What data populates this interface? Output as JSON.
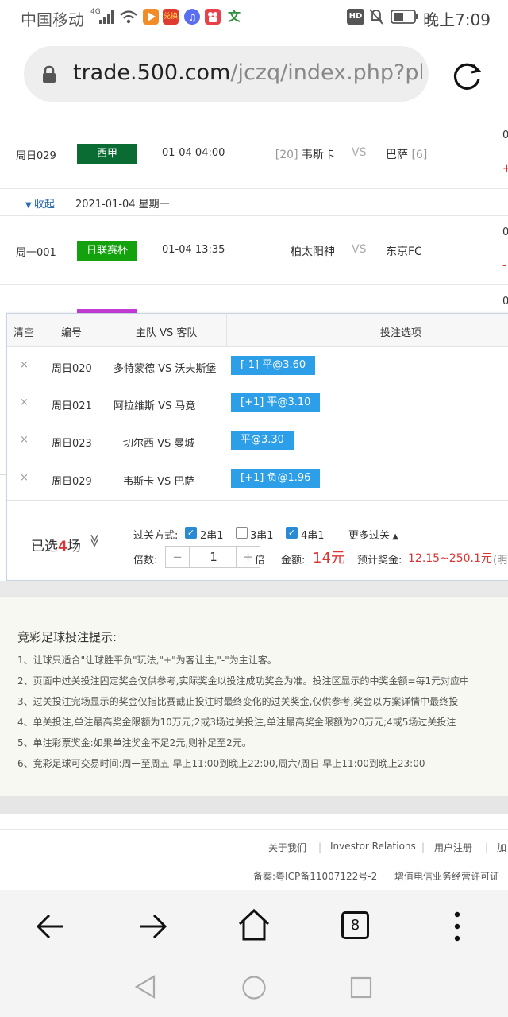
{
  "status": {
    "carrier": "中国移动",
    "net": "4G",
    "hd": "HD",
    "time": "晚上7:09",
    "app_icon_3_text": "兑换",
    "app_icon_6_text": "文"
  },
  "browser": {
    "url_domain": "trade.500.com",
    "url_path": "/jczq/index.php?pla",
    "tab_count": "8"
  },
  "matches_top": [
    {
      "code": "周日029",
      "league": "西甲",
      "league_color": "#0a6b33",
      "time": "01-04 04:00",
      "home_rank": "[20]",
      "home": "韦斯卡",
      "vs": "VS",
      "away": "巴萨",
      "away_rank": "[6]",
      "edge_top": "0",
      "edge_bottom": "+"
    }
  ],
  "date_row": {
    "collapse_label": "收起",
    "date": "2021-01-04 星期一"
  },
  "matches_mid": [
    {
      "code": "周一001",
      "league": "日联赛杯",
      "league_color": "#13a10e",
      "time": "01-04 13:35",
      "home": "柏太阳神",
      "vs": "VS",
      "away": "东京FC",
      "edge_top": "0",
      "edge_bottom": "-"
    }
  ],
  "partial_row": {
    "edge_top": "0",
    "league_color": "#c23bd4"
  },
  "bet_panel": {
    "headers": {
      "clear": "清空",
      "code": "编号",
      "teams": "主队 VS 客队",
      "options": "投注选项"
    },
    "rows": [
      {
        "code": "周日020",
        "teams": "多特蒙德 VS 沃夫斯堡",
        "option": "[-1] 平@3.60"
      },
      {
        "code": "周日021",
        "teams": "阿拉维斯 VS 马竞",
        "option": "[+1] 平@3.10"
      },
      {
        "code": "周日023",
        "teams": "切尔西 VS 曼城",
        "option": "平@3.30"
      },
      {
        "code": "周日029",
        "teams": "韦斯卡 VS 巴萨",
        "option": "[+1] 负@1.96"
      }
    ],
    "remove_glyph": "×",
    "selected_prefix": "已选",
    "selected_count": "4",
    "selected_suffix": "场",
    "collapse_glyph": "≫",
    "pass_label": "过关方式:",
    "pass_options": [
      {
        "label": "2串1",
        "checked": true
      },
      {
        "label": "3串1",
        "checked": false
      },
      {
        "label": "4串1",
        "checked": true
      }
    ],
    "more_pass": "更多过关",
    "multiplier_label": "倍数:",
    "multiplier_value": "1",
    "multiplier_unit": "倍",
    "amount_label": "金额:",
    "amount_value": "14元",
    "prize_label": "预计奖金:",
    "prize_value": "12.15~250.1元",
    "prize_suffix": "(明"
  },
  "tips": {
    "title": "竞彩足球投注提示:",
    "items": [
      "1、让球只适合\"让球胜平负\"玩法,\"+\"为客让主,\"-\"为主让客。",
      "2、页面中过关投注固定奖金仅供参考,实际奖金以投注成功奖金为准。投注区显示的中奖金额=每1元对应中",
      "3、过关投注完场显示的奖金仅指比赛截止投注时最终变化的过关奖金,仅供参考,奖金以方案详情中最终投",
      "4、单关投注,单注最高奖金限额为10万元;2或3场过关投注,单注最高奖金限额为20万元;4或5场过关投注",
      "5、单注彩票奖金:如果单注奖金不足2元,则补足至2元。",
      "6、竞彩足球可交易时间:周一至周五 早上11:00到晚上22:00,周六/周日 早上11:00到晚上23:00"
    ]
  },
  "footer": {
    "links": [
      "关于我们",
      "Investor Relations",
      "用户注册",
      "加"
    ],
    "separator": "|",
    "icp": "备案:粤ICP备11007122号-2",
    "license": "增值电信业务经营许可证"
  }
}
